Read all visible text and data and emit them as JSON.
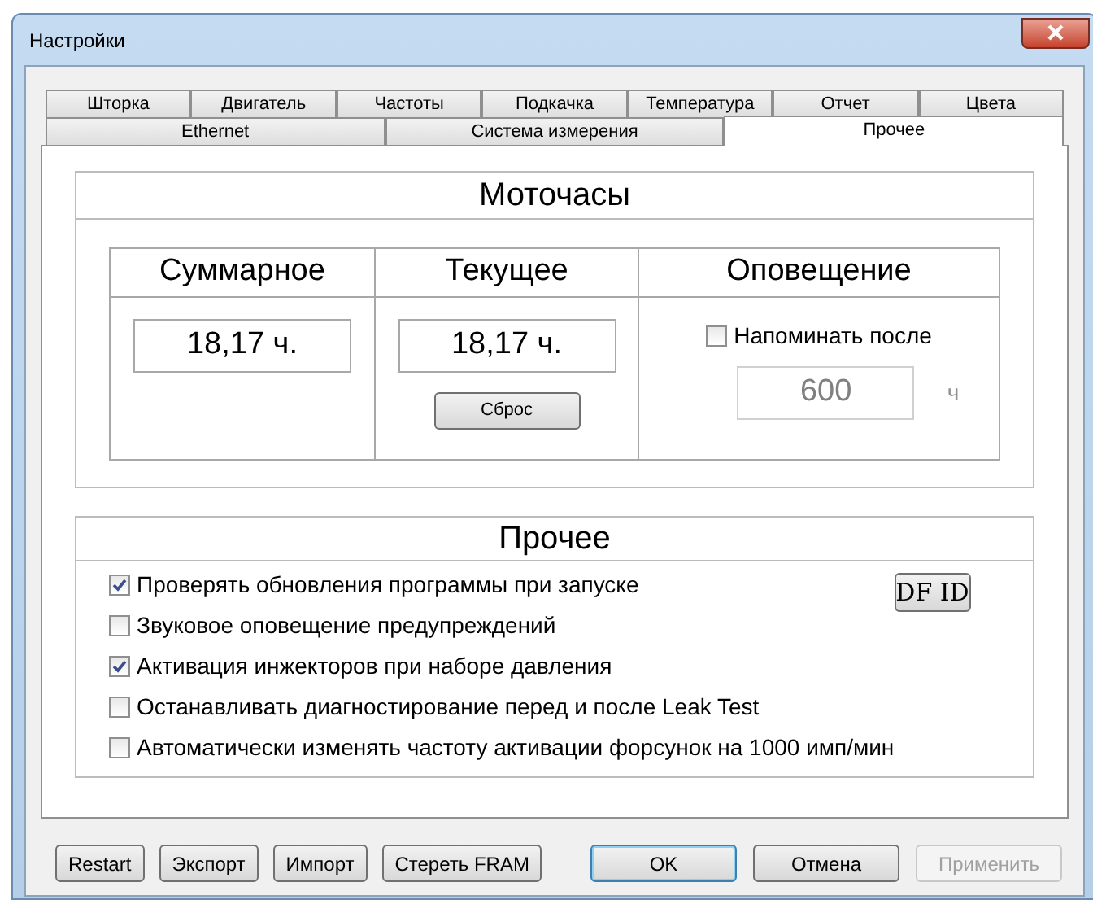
{
  "window": {
    "title": "Настройки"
  },
  "tab_rows": [
    {
      "tabs": [
        {
          "label": "Шторка",
          "selected": false
        },
        {
          "label": "Двигатель",
          "selected": false
        },
        {
          "label": "Частоты",
          "selected": false
        },
        {
          "label": "Подкачка",
          "selected": false
        },
        {
          "label": "Температура",
          "selected": false
        },
        {
          "label": "Отчет",
          "selected": false
        },
        {
          "label": "Цвета",
          "selected": false
        }
      ]
    },
    {
      "tabs": [
        {
          "label": "Ethernet",
          "selected": false
        },
        {
          "label": "Система измерения",
          "selected": false
        },
        {
          "label": "Прочее",
          "selected": true
        }
      ]
    }
  ],
  "motohours": {
    "title": "Моточасы",
    "columns": [
      {
        "heading": "Суммарное",
        "value": "18,17 ч."
      },
      {
        "heading": "Текущее",
        "value": "18,17 ч.",
        "button": "Сброс"
      }
    ],
    "notify": {
      "heading": "Оповещение",
      "label": "Напоминать после",
      "checked": false,
      "value": "600",
      "unit": "ч",
      "disabled": true
    }
  },
  "other": {
    "title": "Прочее",
    "options": [
      {
        "label": "Проверять обновления программы при запуске",
        "checked": true
      },
      {
        "label": "Звуковое оповещение предупреждений",
        "checked": false
      },
      {
        "label": "Активация инжекторов при наборе давления",
        "checked": true
      },
      {
        "label": "Останавливать диагностирование перед и после Leak Test",
        "checked": false
      },
      {
        "label": "Автоматически изменять частоту активации форсунок на 1000 имп/мин",
        "checked": false
      }
    ],
    "side_button": "DF ID"
  },
  "left_buttons": [
    {
      "label": "Restart"
    },
    {
      "label": "Экспорт"
    },
    {
      "label": "Импорт"
    },
    {
      "label": "Стереть FRAM"
    }
  ],
  "right_buttons": [
    {
      "label": "OK",
      "default": true,
      "disabled": false
    },
    {
      "label": "Отмена",
      "default": false,
      "disabled": false
    },
    {
      "label": "Применить",
      "default": false,
      "disabled": true
    }
  ]
}
